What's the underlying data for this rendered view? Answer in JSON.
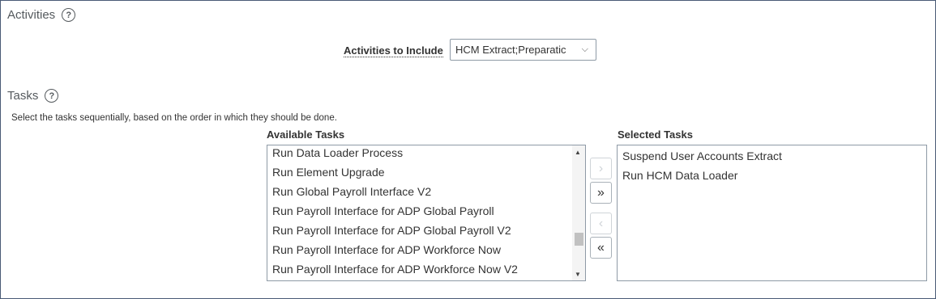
{
  "activities": {
    "title": "Activities",
    "help_glyph": "?",
    "include_label": "Activities to Include",
    "include_value": "HCM Extract;Preparatic",
    "chevron": "⌵"
  },
  "tasks": {
    "title": "Tasks",
    "help_glyph": "?",
    "instructions": "Select the tasks sequentially, based on the order in which they should be done.",
    "available_header": "Available Tasks",
    "selected_header": "Selected Tasks",
    "available": [
      "Run Data Loader Process",
      "Run Element Upgrade",
      "Run Global Payroll Interface V2",
      "Run Payroll Interface for ADP Global Payroll",
      "Run Payroll Interface for ADP Global Payroll V2",
      "Run Payroll Interface for ADP Workforce Now",
      "Run Payroll Interface for ADP Workforce Now V2"
    ],
    "selected": [
      "Suspend User Accounts Extract",
      "Run HCM Data Loader"
    ],
    "buttons": {
      "move": "›",
      "move_all": "»",
      "remove": "‹",
      "remove_all": "«"
    },
    "scroll_up": "▲",
    "scroll_down": "▼"
  }
}
